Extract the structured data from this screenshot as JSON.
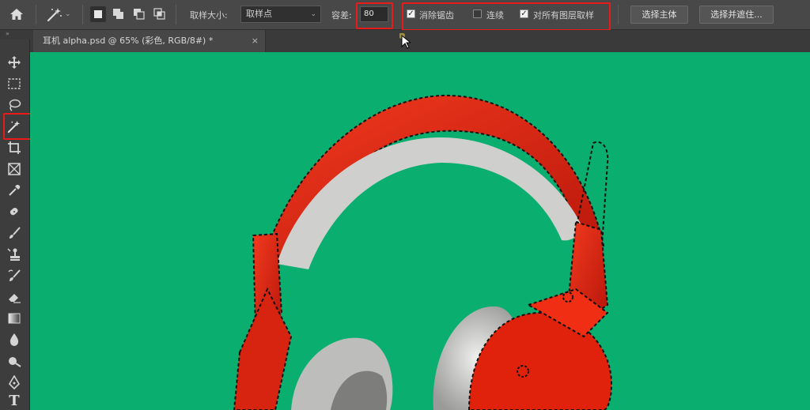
{
  "options_bar": {
    "tool_icon": "magic-wand-icon",
    "sample_size_label": "取样大小:",
    "sample_size_value": "取样点",
    "tolerance_label": "容差:",
    "tolerance_value": "80",
    "anti_alias_label": "消除锯齿",
    "anti_alias_checked": true,
    "contiguous_label": "连续",
    "contiguous_checked": false,
    "sample_all_layers_label": "对所有图层取样",
    "sample_all_layers_checked": true,
    "select_subject_label": "选择主体",
    "select_and_mask_label": "选择并遮住..."
  },
  "document": {
    "tab_title": "耳机 alpha.psd @ 65% (彩色, RGB/8#) *",
    "close_glyph": "×"
  },
  "toolbar": {
    "tools": [
      "move-icon",
      "marquee-icon",
      "lasso-icon",
      "magic-wand-icon",
      "crop-icon",
      "frame-icon",
      "eyedropper-icon",
      "healing-brush-icon",
      "brush-icon",
      "clone-stamp-icon",
      "history-brush-icon",
      "eraser-icon",
      "gradient-icon",
      "blur-icon",
      "dodge-icon",
      "pen-icon",
      "type-icon"
    ],
    "active_tool": "magic-wand-icon",
    "type_tool_glyph": "T"
  },
  "colors": {
    "canvas_bg": "#0aae6f",
    "highlight": "#e81b1b",
    "headphone_red": "#e0220c",
    "headphone_gray": "#c9cac8"
  }
}
